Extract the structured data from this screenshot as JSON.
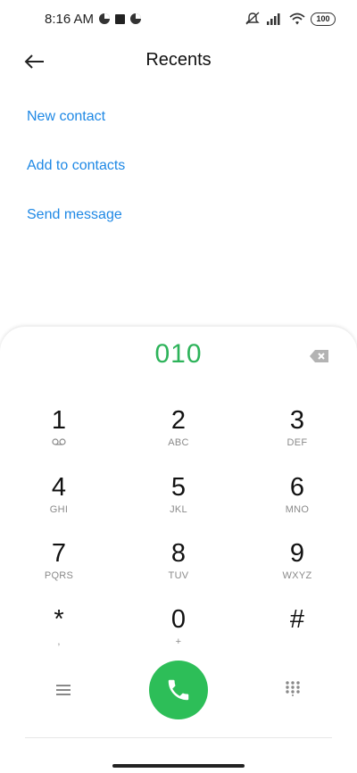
{
  "status_bar": {
    "time": "8:16 AM",
    "battery": "100"
  },
  "header": {
    "title": "Recents"
  },
  "actions": [
    "New contact",
    "Add to contacts",
    "Send message"
  ],
  "dialer": {
    "number": "010",
    "keys": [
      {
        "digit": "1",
        "letters": ""
      },
      {
        "digit": "2",
        "letters": "ABC"
      },
      {
        "digit": "3",
        "letters": "DEF"
      },
      {
        "digit": "4",
        "letters": "GHI"
      },
      {
        "digit": "5",
        "letters": "JKL"
      },
      {
        "digit": "6",
        "letters": "MNO"
      },
      {
        "digit": "7",
        "letters": "PQRS"
      },
      {
        "digit": "8",
        "letters": "TUV"
      },
      {
        "digit": "9",
        "letters": "WXYZ"
      },
      {
        "digit": "*",
        "letters": ","
      },
      {
        "digit": "0",
        "letters": "+"
      },
      {
        "digit": "#",
        "letters": ""
      }
    ]
  },
  "colors": {
    "accent_link": "#1e88e5",
    "dial_green": "#2db35a",
    "call_button": "#2dbe58"
  },
  "icons": {
    "back": "arrow-left-icon",
    "backspace": "backspace-icon",
    "voicemail": "voicemail-icon",
    "menu": "menu-icon",
    "call": "phone-icon",
    "keypad": "dialpad-grid-icon"
  }
}
